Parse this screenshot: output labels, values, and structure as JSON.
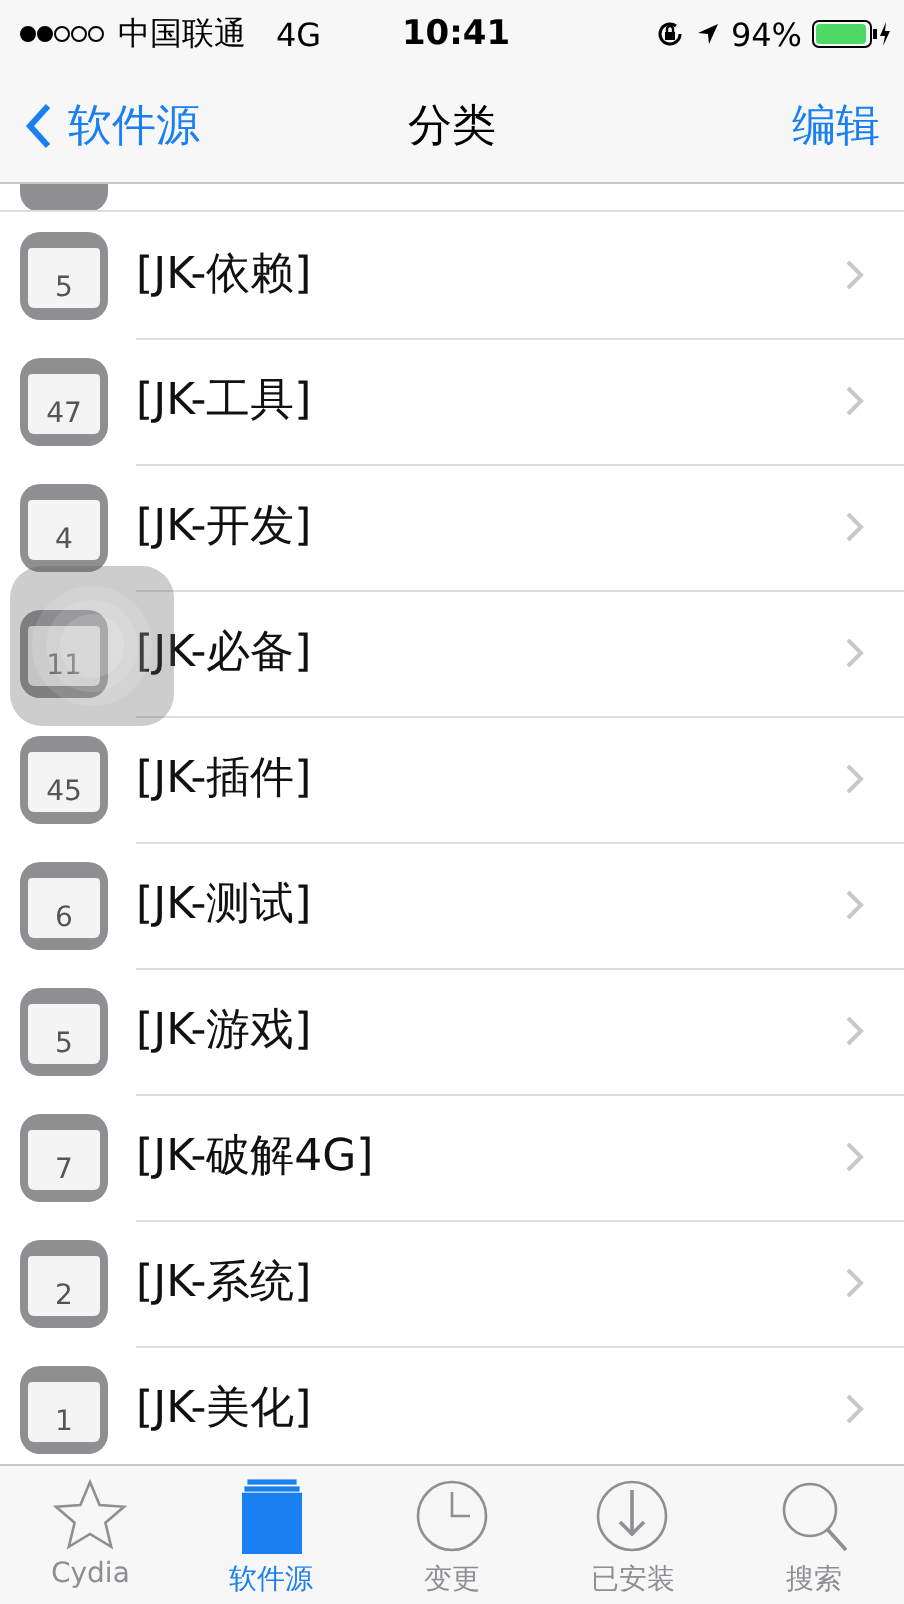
{
  "status_bar": {
    "carrier": "中国联通",
    "network": "4G",
    "time": "10:41",
    "battery": "94%"
  },
  "nav_bar": {
    "back": "软件源",
    "title": "分类",
    "action": "编辑"
  },
  "sections": [
    {
      "name": "[JK-依赖]",
      "count": "5"
    },
    {
      "name": "[JK-工具]",
      "count": "47"
    },
    {
      "name": "[JK-开发]",
      "count": "4"
    },
    {
      "name": "[JK-必备]",
      "count": "11"
    },
    {
      "name": "[JK-插件]",
      "count": "45"
    },
    {
      "name": "[JK-测试]",
      "count": "6"
    },
    {
      "name": "[JK-游戏]",
      "count": "5"
    },
    {
      "name": "[JK-破解4G]",
      "count": "7"
    },
    {
      "name": "[JK-系统]",
      "count": "2"
    },
    {
      "name": "[JK-美化]",
      "count": "1"
    }
  ],
  "tab_bar": [
    {
      "label": "Cydia",
      "kind": "star",
      "selected": false
    },
    {
      "label": "软件源",
      "kind": "sources",
      "selected": true
    },
    {
      "label": "变更",
      "kind": "clock",
      "selected": false
    },
    {
      "label": "已安装",
      "kind": "download",
      "selected": false
    },
    {
      "label": "搜索",
      "kind": "search",
      "selected": false
    }
  ]
}
